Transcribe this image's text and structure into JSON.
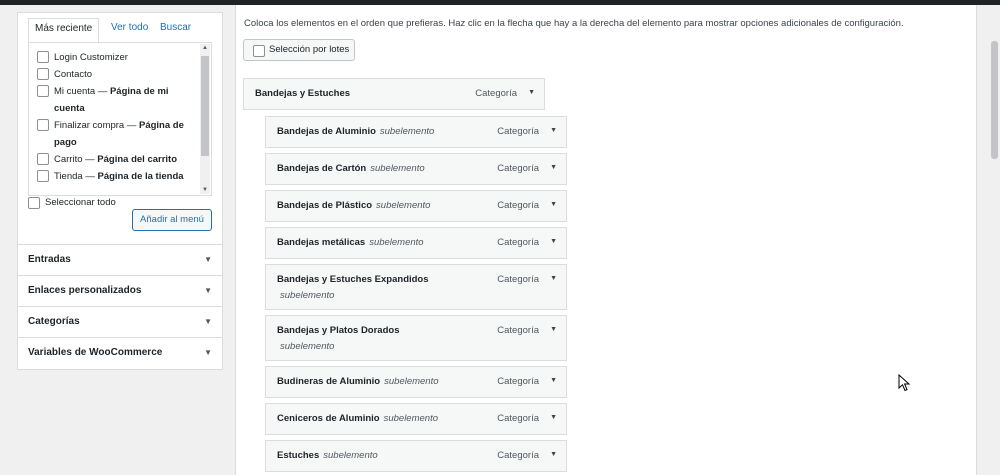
{
  "left_panel": {
    "tabs": [
      "Más reciente",
      "Ver todo",
      "Buscar"
    ],
    "items": [
      {
        "label": "Login Customizer",
        "extra": ""
      },
      {
        "label": "Contacto",
        "extra": ""
      },
      {
        "label": "Mi cuenta — ",
        "extra": "Página de mi cuenta"
      },
      {
        "label": "Finalizar compra — ",
        "extra": "Página de pago"
      },
      {
        "label": "Carrito — ",
        "extra": "Página del carrito"
      },
      {
        "label": "Tienda — ",
        "extra": "Página de la tienda"
      }
    ],
    "select_all": "Seleccionar todo",
    "add_button": "Añadir al menú",
    "accordions": [
      "Entradas",
      "Enlaces personalizados",
      "Categorías",
      "Variables de WooCommerce"
    ]
  },
  "main": {
    "instructions": "Coloca los elementos en el orden que prefieras. Haz clic en la flecha que hay a la derecha del elemento para mostrar opciones adicionales de configuración.",
    "bulk_label": "Selección por lotes",
    "menu_items": [
      {
        "title": "Bandejas y Estuches",
        "sub": "",
        "type": "Categoría",
        "level": 0
      },
      {
        "title": "Bandejas de Aluminio",
        "sub": "subelemento",
        "type": "Categoría",
        "level": 1
      },
      {
        "title": "Bandejas de Cartón",
        "sub": "subelemento",
        "type": "Categoría",
        "level": 1
      },
      {
        "title": "Bandejas de Plástico",
        "sub": "subelemento",
        "type": "Categoría",
        "level": 1
      },
      {
        "title": "Bandejas metálicas",
        "sub": "subelemento",
        "type": "Categoría",
        "level": 1
      },
      {
        "title": "Bandejas y Estuches Expandidos",
        "sub": "subelemento",
        "type": "Categoría",
        "level": 1,
        "wrap": true
      },
      {
        "title": "Bandejas y Platos Dorados",
        "sub": "subelemento",
        "type": "Categoría",
        "level": 1,
        "wrap": true
      },
      {
        "title": "Budineras de Aluminio",
        "sub": "subelemento",
        "type": "Categoría",
        "level": 1
      },
      {
        "title": "Ceniceros de Aluminio",
        "sub": "subelemento",
        "type": "Categoría",
        "level": 1
      },
      {
        "title": "Estuches",
        "sub": "subelemento",
        "type": "Categoría",
        "level": 1
      }
    ]
  }
}
